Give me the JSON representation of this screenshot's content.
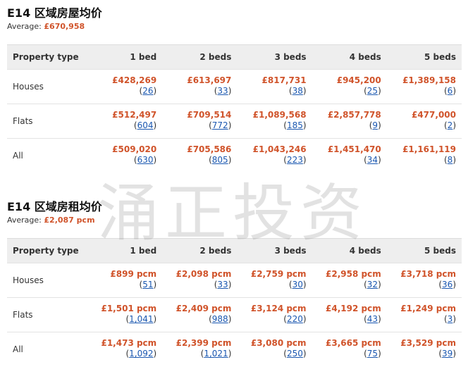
{
  "sale": {
    "title": "E14 区域房屋均价",
    "average_label": "Average:",
    "average_value": "£670,958",
    "headers": [
      "Property type",
      "1 bed",
      "2 beds",
      "3 beds",
      "4 beds",
      "5 beds"
    ],
    "rows": [
      {
        "type": "Houses",
        "cells": [
          {
            "price": "£428,269",
            "count": "26"
          },
          {
            "price": "£613,697",
            "count": "33"
          },
          {
            "price": "£817,731",
            "count": "38"
          },
          {
            "price": "£945,200",
            "count": "25"
          },
          {
            "price": "£1,389,158",
            "count": "6"
          }
        ]
      },
      {
        "type": "Flats",
        "cells": [
          {
            "price": "£512,497",
            "count": "604"
          },
          {
            "price": "£709,514",
            "count": "772"
          },
          {
            "price": "£1,089,568",
            "count": "185"
          },
          {
            "price": "£2,857,778",
            "count": "9"
          },
          {
            "price": "£477,000",
            "count": "2"
          }
        ]
      },
      {
        "type": "All",
        "cells": [
          {
            "price": "£509,020",
            "count": "630"
          },
          {
            "price": "£705,586",
            "count": "805"
          },
          {
            "price": "£1,043,246",
            "count": "223"
          },
          {
            "price": "£1,451,470",
            "count": "34"
          },
          {
            "price": "£1,161,119",
            "count": "8"
          }
        ]
      }
    ]
  },
  "rent": {
    "title": "E14 区域房租均价",
    "average_label": "Average:",
    "average_value": "£2,087 pcm",
    "headers": [
      "Property type",
      "1 bed",
      "2 beds",
      "3 beds",
      "4 beds",
      "5 beds"
    ],
    "rows": [
      {
        "type": "Houses",
        "cells": [
          {
            "price": "£899 pcm",
            "count": "51"
          },
          {
            "price": "£2,098 pcm",
            "count": "33"
          },
          {
            "price": "£2,759 pcm",
            "count": "30"
          },
          {
            "price": "£2,958 pcm",
            "count": "32"
          },
          {
            "price": "£3,718 pcm",
            "count": "36"
          }
        ]
      },
      {
        "type": "Flats",
        "cells": [
          {
            "price": "£1,501 pcm",
            "count": "1,041"
          },
          {
            "price": "£2,409 pcm",
            "count": "988"
          },
          {
            "price": "£3,124 pcm",
            "count": "220"
          },
          {
            "price": "£4,192 pcm",
            "count": "43"
          },
          {
            "price": "£1,249 pcm",
            "count": "3"
          }
        ]
      },
      {
        "type": "All",
        "cells": [
          {
            "price": "£1,473 pcm",
            "count": "1,092"
          },
          {
            "price": "£2,399 pcm",
            "count": "1,021"
          },
          {
            "price": "£3,080 pcm",
            "count": "250"
          },
          {
            "price": "£3,665 pcm",
            "count": "75"
          },
          {
            "price": "£3,529 pcm",
            "count": "39"
          }
        ]
      }
    ]
  },
  "watermark": "涌正投资",
  "colors": {
    "price": "#d0532a",
    "link": "#1a57b0",
    "header_bg": "#eeeeee"
  }
}
